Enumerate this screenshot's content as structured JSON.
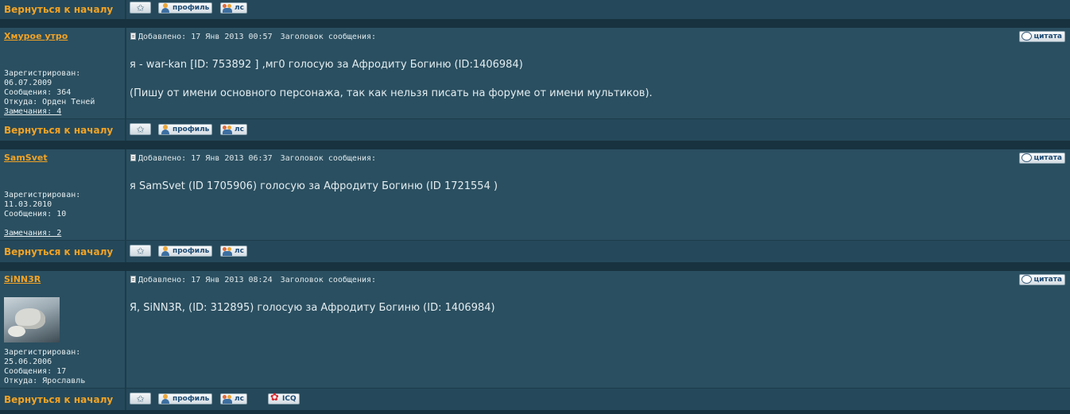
{
  "nav": {
    "back_to_top": "Вернуться к началу"
  },
  "buttons": {
    "profile": "профиль",
    "pm": "лс",
    "icq": "ICQ",
    "quote": "цитата"
  },
  "labels": {
    "posted": "Добавлено:",
    "subject": "Заголовок сообщения:"
  },
  "posts": [
    {
      "username": "Хмурое утро",
      "info": {
        "registered_label": "Зарегистрирован:",
        "registered": "06.07.2009",
        "messages": "Сообщения: 364",
        "location": "Откуда: Орден Теней",
        "warnings": "Замечания: 4"
      },
      "date": "17 Янв 2013 00:57",
      "text_1": "я - war-kan [ID: 753892 ] ,мг0 голосую за Афродиту Богиню (ID:1406984)",
      "text_2": "(Пишу от имени основного персонажа, так как нельзя писать на форуме от имени мультиков)."
    },
    {
      "username": "SamSvet",
      "info": {
        "registered_label": "Зарегистрирован:",
        "registered": "11.03.2010",
        "messages": "Сообщения: 10",
        "warnings": "Замечания: 2"
      },
      "date": "17 Янв 2013 06:37",
      "text_1": "я SamSvet (ID 1705906) голосую за Афродиту Богиню (ID 1721554 )"
    },
    {
      "username": "SiNN3R",
      "info": {
        "registered_label": "Зарегистрирован:",
        "registered": "25.06.2006",
        "messages": "Сообщения: 17",
        "location": "Откуда: Ярославль"
      },
      "date": "17 Янв 2013 08:24",
      "text_1": "Я, SiNN3R, (ID: 312895) голосую за Афродиту Богиню (ID: 1406984)"
    }
  ],
  "icons": {
    "post": "document-icon",
    "star": "star-icon",
    "profile": "person-icon",
    "pm": "people-icon",
    "icq": "flower-icon",
    "quote": "speech-bubble-icon"
  }
}
